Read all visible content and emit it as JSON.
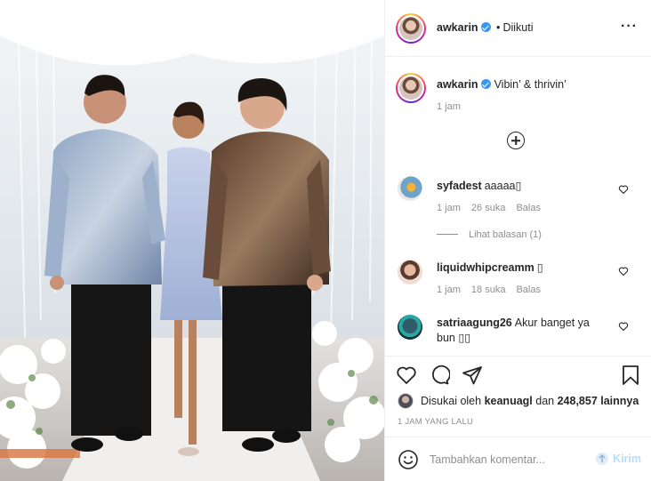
{
  "post": {
    "username": "awkarin",
    "separator": "•",
    "follow_status": "Diikuti",
    "more_icon": "more-horizontal-icon"
  },
  "caption": {
    "username": "awkarin",
    "text": "Vibin’ & thrivin’",
    "time": "1 jam"
  },
  "comments": [
    {
      "username": "syfadest",
      "text": "aaaaa▯",
      "time": "1 jam",
      "likes": "26 suka",
      "reply": "Balas"
    },
    {
      "username": "liquidwhipcreamm",
      "text": "▯",
      "time": "1 jam",
      "likes": "18 suka",
      "reply": "Balas"
    },
    {
      "username": "satriaagung26",
      "text": "Akur banget ya",
      "text2": "bun ▯▯"
    }
  ],
  "view_replies": "Lihat balasan (1)",
  "likes": {
    "prefix": "Disukai oleh",
    "user": "keanuagl",
    "joiner": "dan",
    "count": "248,857 lainnya"
  },
  "time_ago": "1 JAM YANG LALU",
  "add_comment": {
    "placeholder": "Tambahkan komentar...",
    "send": "Kirim"
  },
  "colors": {
    "verified": "#3897f0",
    "send_disabled": "#b2dffc",
    "muted": "#8e8e8e"
  }
}
